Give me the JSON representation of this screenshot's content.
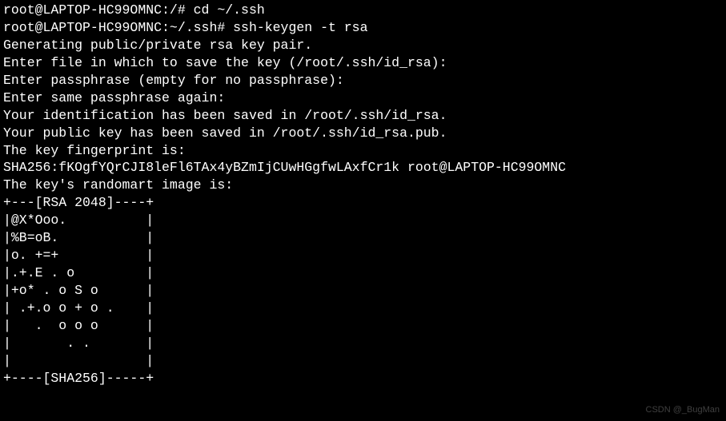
{
  "terminal": {
    "lines": [
      "root@LAPTOP-HC99OMNC:/# cd ~/.ssh",
      "root@LAPTOP-HC99OMNC:~/.ssh# ssh-keygen -t rsa",
      "Generating public/private rsa key pair.",
      "Enter file in which to save the key (/root/.ssh/id_rsa):",
      "Enter passphrase (empty for no passphrase):",
      "Enter same passphrase again:",
      "Your identification has been saved in /root/.ssh/id_rsa.",
      "Your public key has been saved in /root/.ssh/id_rsa.pub.",
      "The key fingerprint is:",
      "SHA256:fKOgfYQrCJI8leFl6TAx4yBZmIjCUwHGgfwLAxfCr1k root@LAPTOP-HC99OMNC",
      "The key's randomart image is:",
      "+---[RSA 2048]----+",
      "|@X*Ooo.          |",
      "|%B=oB.           |",
      "|o. +=+           |",
      "|.+.E . o         |",
      "|+o* . o S o      |",
      "| .+.o o + o .    |",
      "|   .  o o o      |",
      "|       . .       |",
      "|                 |",
      "+----[SHA256]-----+"
    ]
  },
  "watermark": "CSDN @_BugMan"
}
